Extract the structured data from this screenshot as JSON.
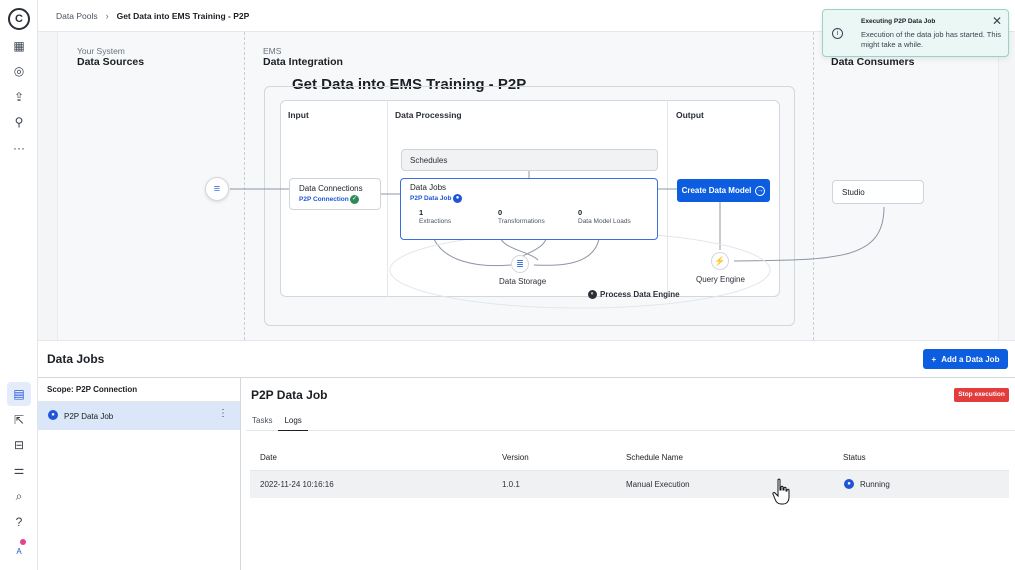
{
  "breadcrumb": {
    "root": "Data Pools",
    "current": "Get Data into EMS Training - P2P"
  },
  "toast": {
    "title": "Executing P2P Data Job",
    "message": "Execution of the data job has started. This might take a while."
  },
  "diagram": {
    "title": "Get Data into EMS Training - P2P",
    "zones": {
      "sources": {
        "sub": "Your System",
        "title": "Data Sources"
      },
      "integration": {
        "sub": "EMS",
        "title": "Data Integration"
      },
      "consumers": {
        "title": "Data Consumers"
      }
    },
    "columns": {
      "input": "Input",
      "processing": "Data Processing",
      "output": "Output"
    },
    "schedules": "Schedules",
    "data_connections": {
      "title": "Data Connections",
      "sub": "P2P Connection"
    },
    "data_jobs": {
      "title": "Data Jobs",
      "sub": "P2P Data Job",
      "metrics": [
        {
          "value": "1",
          "label": "Extractions"
        },
        {
          "value": "0",
          "label": "Transformations"
        },
        {
          "value": "0",
          "label": "Data Model Loads"
        }
      ]
    },
    "create_data_model": "Create Data Model",
    "data_storage": "Data Storage",
    "query_engine": "Query Engine",
    "process_data_engine": "Process Data Engine",
    "studio": "Studio"
  },
  "jobs": {
    "title": "Data Jobs",
    "add_button": "Add a Data Job",
    "scope_label": "Scope: P2P Connection",
    "items": [
      {
        "label": "P2P Data Job"
      }
    ],
    "detail": {
      "title": "P2P Data Job",
      "stop_button": "Stop execution",
      "tabs": [
        "Tasks",
        "Logs"
      ],
      "active_tab": "Logs",
      "columns": [
        "Date",
        "Version",
        "Schedule Name",
        "Status"
      ],
      "rows": [
        {
          "date": "2022-11-24 10:16:16",
          "version": "1.0.1",
          "schedule": "Manual Execution",
          "status": "Running"
        }
      ]
    }
  },
  "colors": {
    "accent": "#0d5de0",
    "danger": "#e23c3c",
    "toast_bg": "#eaf7f4",
    "selected": "#dbe6f8"
  },
  "rail_icons": [
    "apps-icon",
    "compass-icon",
    "upload-icon",
    "magnifier-tool-icon",
    "more-icon",
    "database-icon",
    "export-icon",
    "package-icon",
    "sliders-icon",
    "search-icon",
    "help-icon"
  ]
}
